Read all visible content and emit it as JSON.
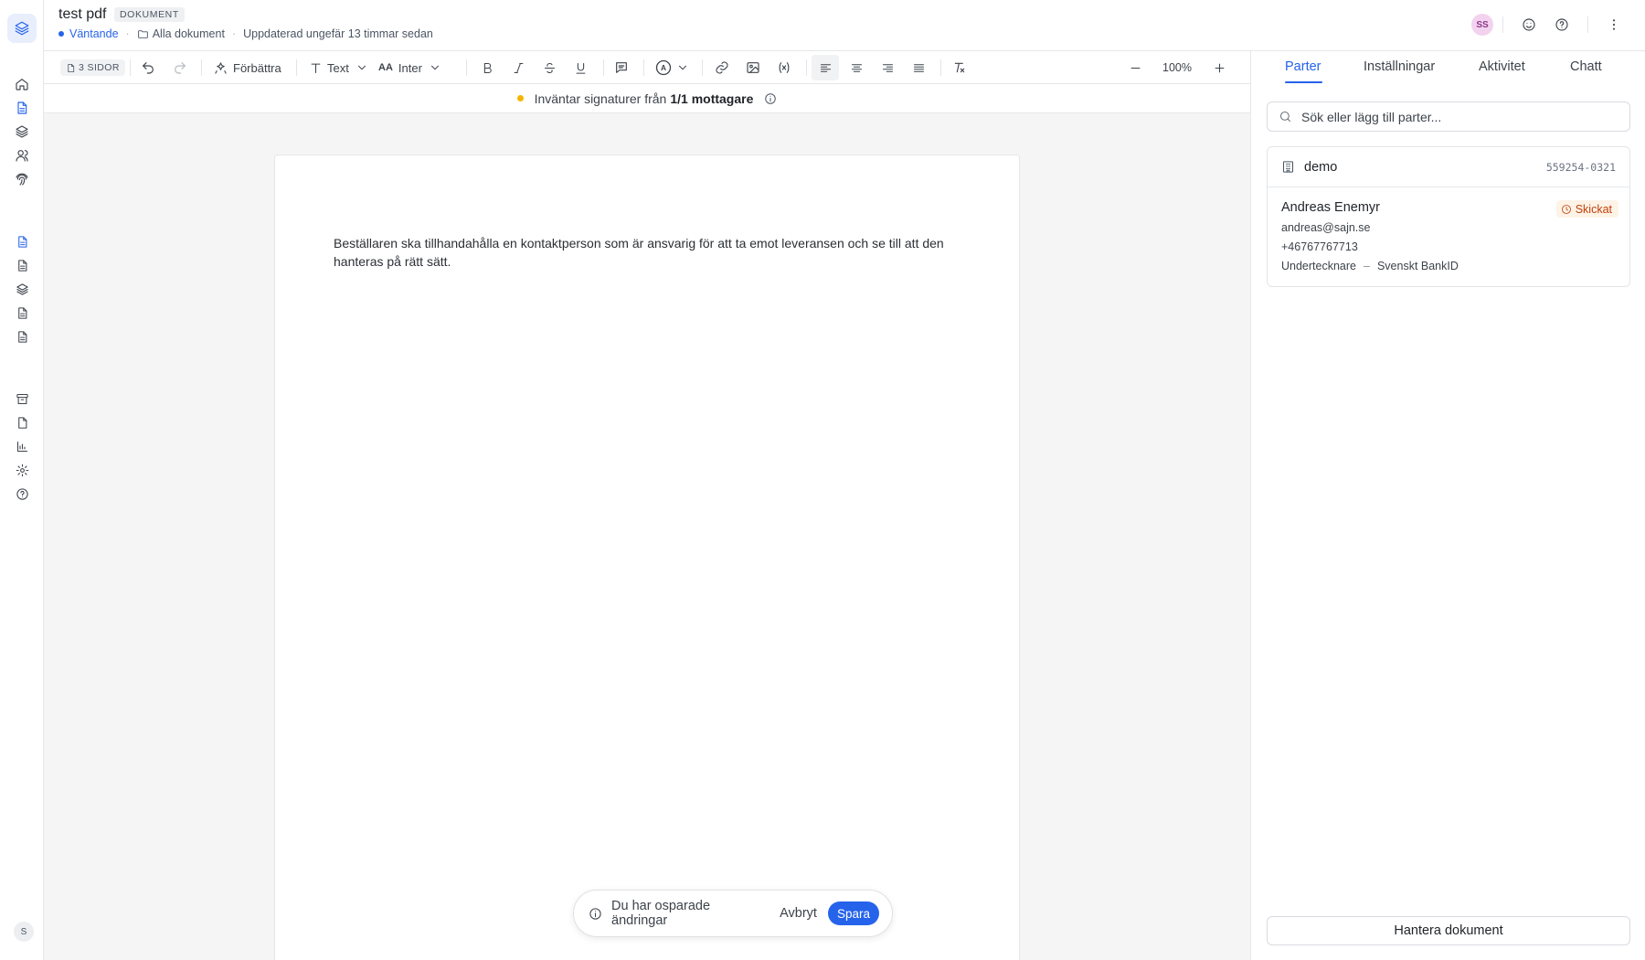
{
  "header": {
    "title": "test pdf",
    "type_badge": "DOKUMENT",
    "status": "Väntande",
    "folder": "Alla dokument",
    "updated": "Uppdaterad ungefär 13 timmar sedan",
    "avatar_initials": "SS"
  },
  "toolbar": {
    "pages": "3 SIDOR",
    "improve_label": "Förbättra",
    "text_style": "Text",
    "font": "Inter",
    "zoom": "100%"
  },
  "banner": {
    "text": "Inväntar signaturer från",
    "count": "1/1 mottagare"
  },
  "document": {
    "body": "Beställaren ska tillhandahålla en kontaktperson som är ansvarig för att ta emot leveransen och se till att den hanteras på rätt sätt."
  },
  "unsaved_bar": {
    "message": "Du har osparade ändringar",
    "cancel_label": "Avbryt",
    "save_label": "Spara"
  },
  "panel": {
    "tabs": [
      {
        "label": "Parter"
      },
      {
        "label": "Inställningar"
      },
      {
        "label": "Aktivitet"
      },
      {
        "label": "Chatt"
      }
    ],
    "search_placeholder": "Sök eller lägg till parter...",
    "party": {
      "company": "demo",
      "org_number": "559254-0321",
      "signer": {
        "name": "Andreas Enemyr",
        "status": "Skickat",
        "email": "andreas@sajn.se",
        "phone": "+46767767713",
        "role": "Undertecknare",
        "method": "Svenskt BankID"
      }
    },
    "manage_label": "Hantera dokument"
  },
  "rail": {
    "user_initial": "S"
  },
  "colors": {
    "accent": "#2563eb",
    "pending": "#f5b400",
    "sent_status": "#c2410c"
  }
}
